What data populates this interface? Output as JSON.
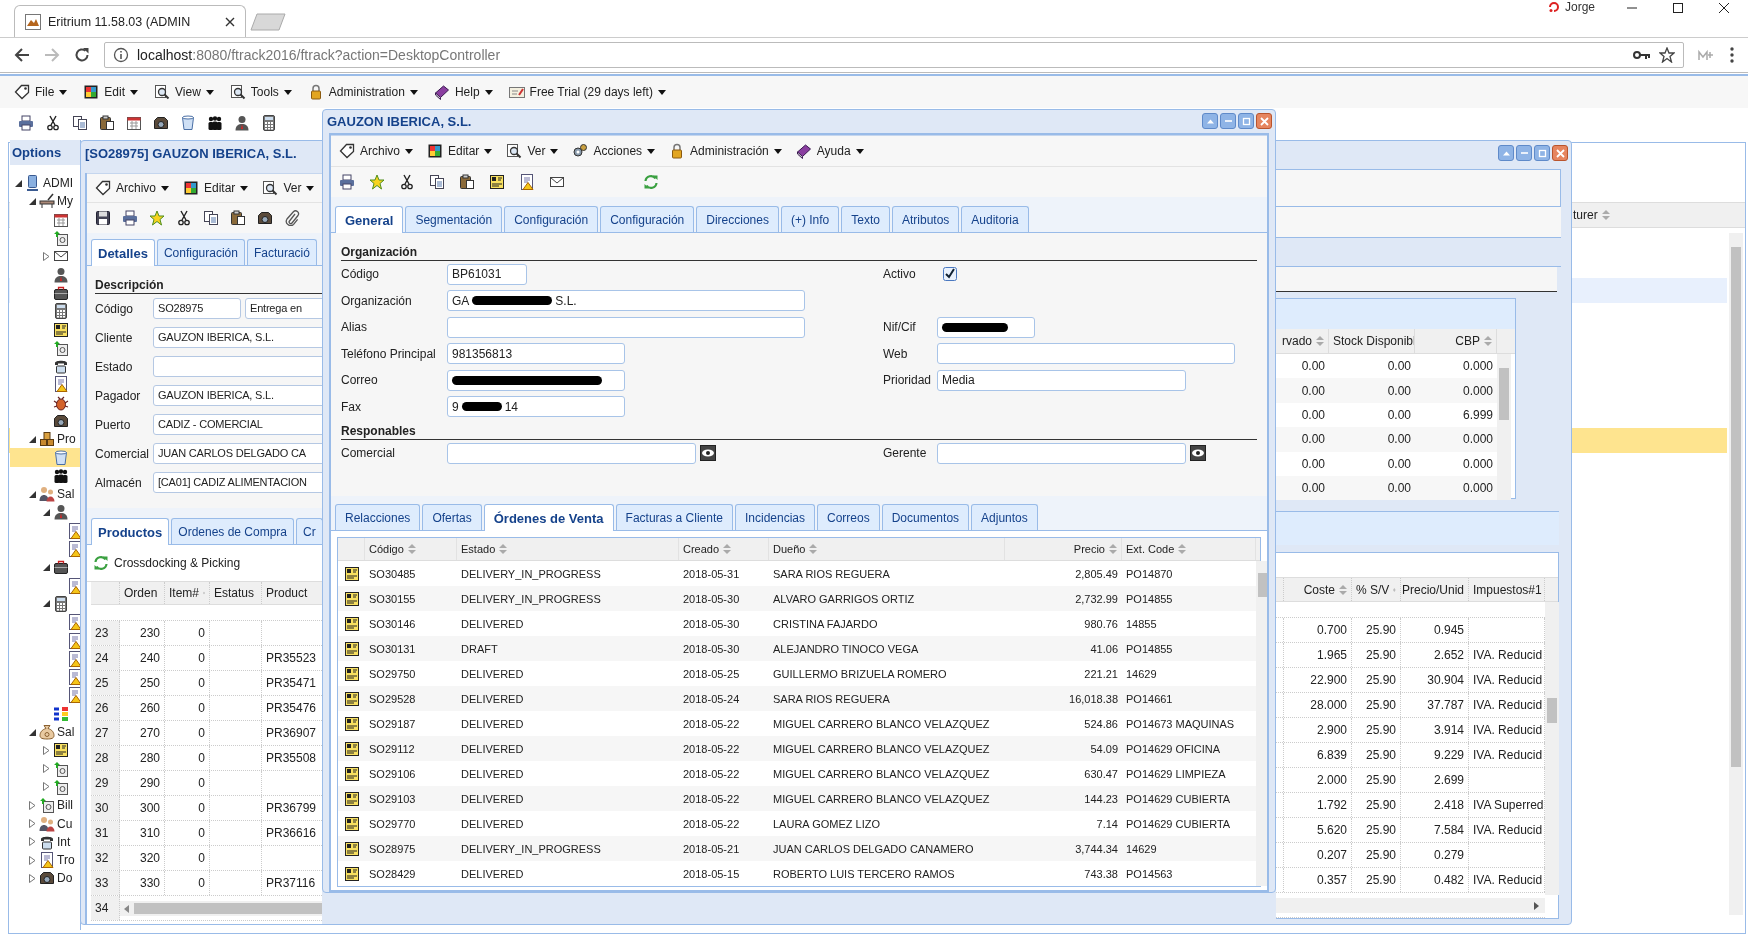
{
  "browser": {
    "tab_title": "Eritrium 11.58.03 (ADMIN",
    "url_host": "localhost",
    "url_path": ":8080/ftrack2016/ftrack?action=DesktopController",
    "profile_name": "Jorge"
  },
  "app_menu": [
    "File",
    "Edit",
    "View",
    "Tools",
    "Administration",
    "Help",
    "Free Trial (29 days left)"
  ],
  "options_panel": {
    "title": "Options",
    "tree": [
      {
        "label": "ADMI",
        "expanded": true,
        "selected": false,
        "children": [
          {
            "label": "My",
            "expanded": true,
            "selected": false,
            "children": [
              {
                "selected": false
              },
              {
                "selected": false
              },
              {
                "expanded": false,
                "selected": false
              },
              {
                "selected": false
              },
              {
                "selected": false
              },
              {
                "selected": false
              },
              {
                "selected": false
              },
              {
                "selected": false
              },
              {
                "selected": false
              },
              {
                "selected": false
              },
              {
                "selected": false
              },
              {
                "selected": false
              }
            ]
          },
          {
            "label": "Pro",
            "expanded": true,
            "selected": false,
            "children": [
              {
                "selected": true
              },
              {
                "selected": false
              }
            ]
          },
          {
            "label": "Sal",
            "expanded": true,
            "selected": false,
            "children": [
              {
                "expanded": true,
                "selected": false,
                "children": [
                  {
                    "selected": false
                  },
                  {
                    "selected": false
                  }
                ]
              },
              {
                "expanded": true,
                "selected": false,
                "children": [
                  {
                    "selected": false
                  }
                ]
              },
              {
                "expanded": true,
                "selected": false,
                "children": [
                  {
                    "selected": false
                  },
                  {
                    "selected": false
                  },
                  {
                    "selected": false
                  },
                  {
                    "selected": false
                  },
                  {
                    "selected": false
                  }
                ]
              },
              {
                "selected": false
              }
            ]
          },
          {
            "label": "Sal",
            "expanded": true,
            "selected": false,
            "children": [
              {
                "expanded": false,
                "selected": false
              },
              {
                "expanded": false,
                "selected": false
              },
              {
                "expanded": false,
                "selected": false
              }
            ]
          },
          {
            "label": "Bill",
            "expanded": false,
            "selected": false
          },
          {
            "label": "Cu",
            "expanded": false,
            "selected": false
          },
          {
            "label": "Int",
            "expanded": false,
            "selected": false
          },
          {
            "label": "Tro",
            "expanded": false,
            "selected": false
          },
          {
            "label": "Do",
            "expanded": false,
            "selected": false
          }
        ]
      }
    ]
  },
  "background_window": {
    "column_header": "turer",
    "rows": [
      {
        "selected": false,
        "highlighted": false
      },
      {
        "selected": false,
        "highlighted": false
      },
      {
        "selected": false,
        "highlighted": true
      },
      {
        "selected": false,
        "highlighted": false
      },
      {
        "selected": false,
        "highlighted": false
      },
      {
        "selected": false,
        "highlighted": false
      },
      {
        "selected": false,
        "highlighted": false
      },
      {
        "selected": false,
        "highlighted": false
      },
      {
        "selected": true,
        "highlighted": false
      }
    ]
  },
  "order_window": {
    "title": "[SO28975] GAUZON IBERICA, S.L.",
    "menu": [
      "Archivo",
      "Editar",
      "Ver"
    ],
    "tabs": [
      {
        "label": "Detalles",
        "selected": true
      },
      {
        "label": "Configuración",
        "selected": false
      },
      {
        "label": "Facturació",
        "selected": false
      }
    ],
    "section": "Descripción",
    "fields": [
      {
        "label": "Código",
        "value": "SO28975",
        "extra": "Entrega en"
      },
      {
        "label": "Cliente",
        "value": "GAUZON IBERICA, S.L."
      },
      {
        "label": "Estado"
      },
      {
        "label": "Pagador",
        "value": "GAUZON IBERICA, S.L."
      },
      {
        "label": "Puerto",
        "value": "CADIZ - COMERCIAL"
      },
      {
        "label": "Comercial",
        "value": "JUAN CARLOS DELGADO CA"
      },
      {
        "label": "Almacén",
        "value": "[CA01] CADIZ ALIMENTACION"
      }
    ],
    "stock_grid": {
      "columns": [
        "rvado",
        "Stock Disponibl",
        "CBP"
      ],
      "rows": [
        [
          "0.00",
          "0.00",
          "0.000"
        ],
        [
          "0.00",
          "0.00",
          "0.000"
        ],
        [
          "0.00",
          "0.00",
          "6.999"
        ],
        [
          "0.00",
          "0.00",
          "0.000"
        ],
        [
          "0.00",
          "0.00",
          "0.000"
        ],
        [
          "0.00",
          "0.00",
          "0.000"
        ]
      ]
    },
    "lower_tabs": [
      {
        "label": "Productos",
        "selected": true
      },
      {
        "label": "Ordenes de Compra",
        "selected": false
      },
      {
        "label": "Cr",
        "selected": false
      }
    ],
    "crossdocking_button": "Crossdocking & Picking",
    "lines_grid": {
      "left_columns": [
        "Orden",
        "Item#",
        "Estatus",
        "Product"
      ],
      "right_columns": [
        "Coste",
        "% S/V",
        "Precio/Unid",
        "Impuestos#1"
      ],
      "rows": [
        {
          "row": "23",
          "orden": "230",
          "item": "0",
          "coste": "0.700",
          "sv": "25.90",
          "precio": "0.945"
        },
        {
          "row": "24",
          "orden": "240",
          "item": "0",
          "producto": "PR35523",
          "coste": "1.965",
          "sv": "25.90",
          "precio": "2.652",
          "impuesto": "IVA. Reducid"
        },
        {
          "row": "25",
          "orden": "250",
          "item": "0",
          "producto": "PR35471",
          "coste": "22.900",
          "sv": "25.90",
          "precio": "30.904",
          "impuesto": "IVA. Reducid"
        },
        {
          "row": "26",
          "orden": "260",
          "item": "0",
          "producto": "PR35476",
          "coste": "28.000",
          "sv": "25.90",
          "precio": "37.787",
          "impuesto": "IVA. Reducid"
        },
        {
          "row": "27",
          "orden": "270",
          "item": "0",
          "producto": "PR36907",
          "coste": "2.900",
          "sv": "25.90",
          "precio": "3.914",
          "impuesto": "IVA. Reducid"
        },
        {
          "row": "28",
          "orden": "280",
          "item": "0",
          "producto": "PR35508",
          "coste": "6.839",
          "sv": "25.90",
          "precio": "9.229",
          "impuesto": "IVA. Reducid"
        },
        {
          "row": "29",
          "orden": "290",
          "item": "0",
          "coste": "2.000",
          "sv": "25.90",
          "precio": "2.699"
        },
        {
          "row": "30",
          "orden": "300",
          "item": "0",
          "producto": "PR36799",
          "coste": "1.792",
          "sv": "25.90",
          "precio": "2.418",
          "impuesto": "IVA Superred"
        },
        {
          "row": "31",
          "orden": "310",
          "item": "0",
          "producto": "PR36616",
          "coste": "5.620",
          "sv": "25.90",
          "precio": "7.584",
          "impuesto": "IVA. Reducid"
        },
        {
          "row": "32",
          "orden": "320",
          "item": "0",
          "coste": "0.207",
          "sv": "25.90",
          "precio": "0.279"
        },
        {
          "row": "33",
          "orden": "330",
          "item": "0",
          "producto": "PR37116",
          "coste": "0.357",
          "sv": "25.90",
          "precio": "0.482",
          "impuesto": "IVA. Reducid"
        },
        {
          "row": "34"
        }
      ]
    }
  },
  "partner_dialog": {
    "title": "GAUZON IBERICA, S.L.",
    "menu": [
      "Archivo",
      "Editar",
      "Ver",
      "Acciones",
      "Administración",
      "Ayuda"
    ],
    "tabs": [
      {
        "label": "General",
        "selected": true
      },
      {
        "label": "Segmentación",
        "selected": false
      },
      {
        "label": "Configuración",
        "selected": false
      },
      {
        "label": "Configuración",
        "selected": false
      },
      {
        "label": "Direcciones",
        "selected": false
      },
      {
        "label": "(+) Info",
        "selected": false
      },
      {
        "label": "Texto",
        "selected": false
      },
      {
        "label": "Atributos",
        "selected": false
      },
      {
        "label": "Auditoria",
        "selected": false
      }
    ],
    "section_organization": "Organización",
    "left_fields": [
      {
        "label": "Código",
        "value_parts": [
          {
            "kind": "text",
            "text": "BP61031"
          }
        ]
      },
      {
        "label": "Organización",
        "value_parts": [
          {
            "kind": "text",
            "text": "GA"
          },
          {
            "kind": "redaction"
          },
          {
            "kind": "text",
            "text": "S.L."
          }
        ]
      },
      {
        "label": "Alias"
      },
      {
        "label": "Teléfono Principal",
        "value_parts": [
          {
            "kind": "text",
            "text": "981356813"
          }
        ]
      },
      {
        "label": "Correo",
        "value_parts": [
          {
            "kind": "redaction"
          }
        ]
      },
      {
        "label": "Fax",
        "value_parts": [
          {
            "kind": "text",
            "text": "9"
          },
          {
            "kind": "redaction"
          },
          {
            "kind": "text",
            "text": "14"
          }
        ]
      }
    ],
    "active": {
      "label": "Activo",
      "checked": true
    },
    "right_fields": [
      {
        "label": "Nif/Cif",
        "value_parts": [
          {
            "kind": "redaction"
          }
        ]
      },
      {
        "label": "Web"
      },
      {
        "label": "Prioridad",
        "value_parts": [
          {
            "kind": "text",
            "text": "Media"
          }
        ]
      }
    ],
    "section_responsibles": "Responables",
    "responsible_fields": [
      {
        "label": "Comercial"
      },
      {
        "label": "Gerente"
      }
    ],
    "lower_tabs": [
      {
        "label": "Relacciones",
        "selected": false
      },
      {
        "label": "Ofertas",
        "selected": false
      },
      {
        "label": "Órdenes de Venta",
        "selected": true
      },
      {
        "label": "Facturas a Cliente",
        "selected": false
      },
      {
        "label": "Incidencias",
        "selected": false
      },
      {
        "label": "Correos",
        "selected": false
      },
      {
        "label": "Documentos",
        "selected": false
      },
      {
        "label": "Adjuntos",
        "selected": false
      }
    ],
    "orders": {
      "columns": [
        "Código",
        "Estado",
        "Creado",
        "Dueño",
        "Precio",
        "Ext. Code"
      ],
      "rows": [
        [
          "SO30485",
          "DELIVERY_IN_PROGRESS",
          "2018-05-31",
          "SARA RIOS REGUERA",
          "2,805.49",
          "PO14870"
        ],
        [
          "SO30155",
          "DELIVERY_IN_PROGRESS",
          "2018-05-30",
          "ALVARO GARRIGOS ORTIZ",
          "2,732.99",
          "PO14855"
        ],
        [
          "SO30146",
          "DELIVERED",
          "2018-05-30",
          "CRISTINA FAJARDO",
          "980.76",
          "14855"
        ],
        [
          "SO30131",
          "DRAFT",
          "2018-05-30",
          "ALEJANDRO TINOCO VEGA",
          "41.06",
          "PO14855"
        ],
        [
          "SO29750",
          "DELIVERED",
          "2018-05-25",
          "GUILLERMO BRIZUELA ROMERO",
          "221.21",
          "14629"
        ],
        [
          "SO29528",
          "DELIVERED",
          "2018-05-24",
          "SARA RIOS REGUERA",
          "16,018.38",
          "PO14661"
        ],
        [
          "SO29187",
          "DELIVERED",
          "2018-05-22",
          "MIGUEL CARRERO BLANCO VELAZQUEZ",
          "524.86",
          "PO14673 MAQUINAS"
        ],
        [
          "SO29112",
          "DELIVERED",
          "2018-05-22",
          "MIGUEL CARRERO BLANCO VELAZQUEZ",
          "54.09",
          "PO14629 OFICINA"
        ],
        [
          "SO29106",
          "DELIVERED",
          "2018-05-22",
          "MIGUEL CARRERO BLANCO VELAZQUEZ",
          "630.47",
          "PO14629 LIMPIEZA"
        ],
        [
          "SO29103",
          "DELIVERED",
          "2018-05-22",
          "MIGUEL CARRERO BLANCO VELAZQUEZ",
          "144.23",
          "PO14629 CUBIERTA"
        ],
        [
          "SO29770",
          "DELIVERED",
          "2018-05-22",
          "LAURA GOMEZ LIZO",
          "7.14",
          "PO14629 CUBIERTA"
        ],
        [
          "SO28975",
          "DELIVERY_IN_PROGRESS",
          "2018-05-21",
          "JUAN CARLOS DELGADO CANAMERO",
          "3,744.34",
          "14629"
        ],
        [
          "SO28429",
          "DELIVERED",
          "2018-05-15",
          "ROBERTO LUIS TERCERO RAMOS",
          "743.38",
          "PO14563"
        ]
      ]
    }
  }
}
